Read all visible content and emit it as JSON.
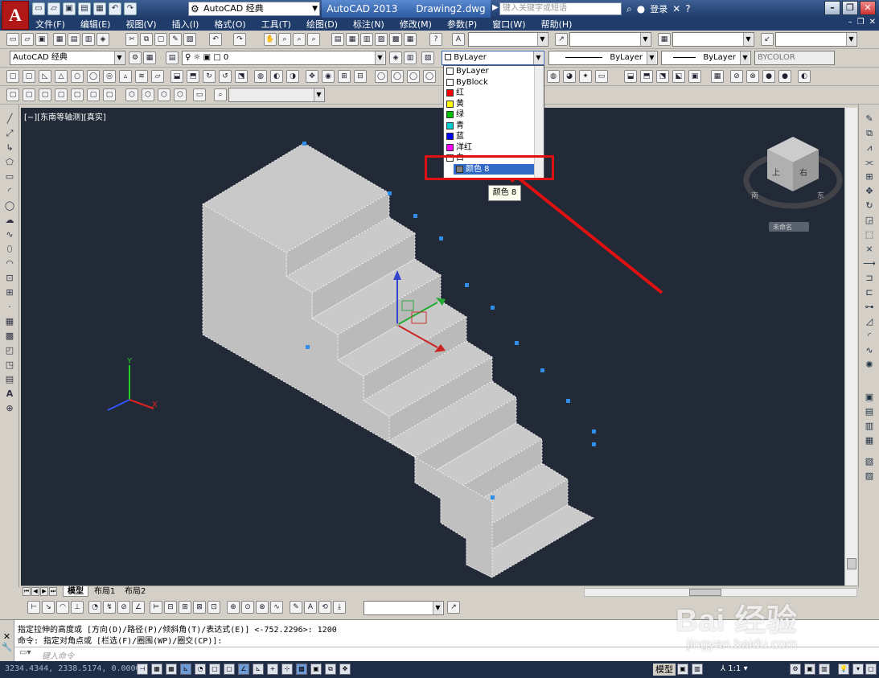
{
  "window": {
    "workspace": "AutoCAD 经典",
    "app_name": "AutoCAD 2013",
    "file_name": "Drawing2.dwg",
    "search_placeholder": "键入关键字或短语",
    "login": "登录"
  },
  "menu": [
    "文件(F)",
    "编辑(E)",
    "视图(V)",
    "插入(I)",
    "格式(O)",
    "工具(T)",
    "绘图(D)",
    "标注(N)",
    "修改(M)",
    "参数(P)",
    "窗口(W)",
    "帮助(H)"
  ],
  "properties_bar": {
    "workspace_combo": "AutoCAD 经典",
    "layer_value": "0",
    "color_value": "ByLayer",
    "linetype_value": "ByLayer",
    "lineweight_value": "ByLayer",
    "plotstyle_value": "BYCOLOR"
  },
  "color_dropdown": {
    "items": [
      {
        "label": "ByLayer",
        "color": "#ffffff"
      },
      {
        "label": "ByBlock",
        "color": "#ffffff"
      },
      {
        "label": "红",
        "color": "#ff0000"
      },
      {
        "label": "黄",
        "color": "#ffff00"
      },
      {
        "label": "绿",
        "color": "#00c000"
      },
      {
        "label": "青",
        "color": "#00d0d0"
      },
      {
        "label": "蓝",
        "color": "#0000ff"
      },
      {
        "label": "洋红",
        "color": "#ff00ff"
      },
      {
        "label": "白",
        "color": "#ffffff"
      },
      {
        "label": "颜色 8",
        "color": "#808080"
      }
    ],
    "selected_label": "颜色 8",
    "tooltip": "颜色 8"
  },
  "viewport": {
    "label": "[−][东南等轴测][真实]",
    "viewcube_faces": [
      "上",
      "右"
    ],
    "compass_letters": [
      "南",
      "东"
    ],
    "ucs_name": "未命名",
    "axis_labels": [
      "X",
      "Y"
    ]
  },
  "layout_tabs": [
    "模型",
    "布局1",
    "布局2"
  ],
  "command": {
    "history_line_1": "指定拉伸的高度或 [方向(D)/路径(P)/倾斜角(T)/表达式(E)] <-752.2296>: 1200",
    "history_line_2": "命令: 指定对角点或 [栏选(F)/圈围(WP)/圈交(CP)]:",
    "input_placeholder": "键入命令"
  },
  "status": {
    "coordinates": "3234.4344, 2338.5174, 0.0000",
    "model_label": "模型",
    "annotation_scale": "1:1"
  },
  "watermark": {
    "brand": "Bai 经验",
    "url": "jingyan.baidu.com"
  },
  "colors": {
    "title_bar": "#1f3c6b",
    "viewport_bg": "#232a37",
    "stair_face": "#c8c8c8",
    "highlight": "#e01010",
    "selection_blue": "#316ac5"
  }
}
